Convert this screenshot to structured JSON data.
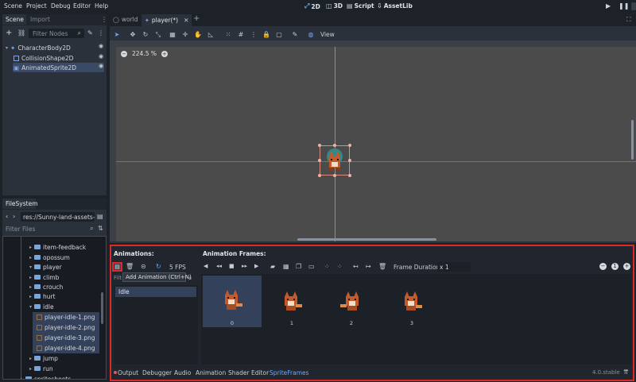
{
  "menu": {
    "items": [
      "Scene",
      "Project",
      "Debug",
      "Editor",
      "Help"
    ]
  },
  "workspaces": {
    "w2d": "2D",
    "w3d": "3D",
    "script": "Script",
    "assetlib": "AssetLib"
  },
  "scene_dock": {
    "tabs": [
      "Scene",
      "Import"
    ],
    "filter_placeholder": "Filter Nodes",
    "nodes": [
      "CharacterBody2D",
      "CollisionShape2D",
      "AnimatedSprite2D"
    ]
  },
  "filesystem": {
    "tab": "FileSystem",
    "path": "res://Sunny-land-assets-file",
    "filter_placeholder": "Filter Files",
    "items": [
      "item-feedback",
      "opossum",
      "player",
      "climb",
      "crouch",
      "hurt",
      "idle",
      "player-idle-1.png",
      "player-idle-2.png",
      "player-idle-3.png",
      "player-idle-4.png",
      "jump",
      "run",
      "spritesheets"
    ]
  },
  "editor_tabs": {
    "tab1": "world",
    "tab2": "player(*)"
  },
  "viewport": {
    "view_menu": "View",
    "zoom": "224.5 %"
  },
  "sprite_frames": {
    "animations_label": "Animations:",
    "frames_label": "Animation Frames:",
    "fps": "5 FPS",
    "tooltip": "Add Animation (Ctrl+N)",
    "filter_prefix": "Filt",
    "animation_list": [
      "Idle"
    ],
    "frame_duration_label": "Frame Duration:",
    "frame_duration_value": "x 1",
    "frames": [
      "0",
      "1",
      "2",
      "3"
    ]
  },
  "bottom_tabs": [
    "Output",
    "Debugger",
    "Audio",
    "Animation",
    "Shader Editor",
    "SpriteFrames"
  ],
  "version": "4.0.stable",
  "colors": {
    "accent": "#5fa8ff",
    "highlight_box": "#e02828",
    "selection": "#34415a"
  }
}
